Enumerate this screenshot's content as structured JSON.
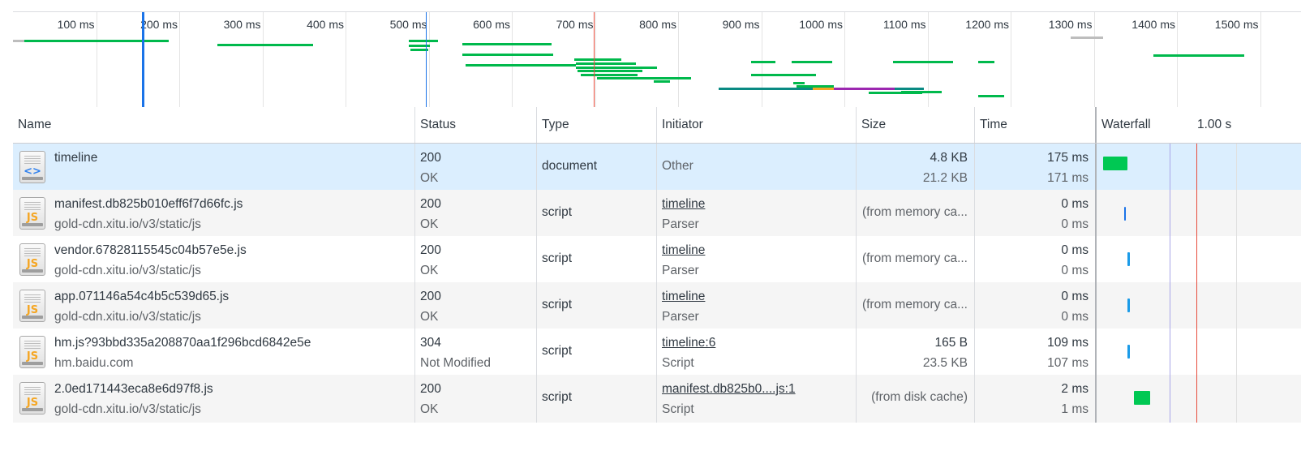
{
  "overview": {
    "tick_labels": [
      "100 ms",
      "200 ms",
      "300 ms",
      "400 ms",
      "500 ms",
      "600 ms",
      "700 ms",
      "800 ms",
      "900 ms",
      "1000 ms",
      "1100 ms",
      "1200 ms",
      "1300 ms",
      "1400 ms",
      "1500 ms"
    ],
    "colors": {
      "waiting": "#00b94c",
      "queued": "#bdbdbd",
      "dom_content_loaded": "#1a73e8",
      "load": "#e74c3c",
      "purple": "#9c27b0",
      "teal": "#0a8a83",
      "orange": "#f5a623"
    }
  },
  "columns": {
    "name": "Name",
    "status": "Status",
    "type": "Type",
    "initiator": "Initiator",
    "size": "Size",
    "time": "Time",
    "waterfall": "Waterfall",
    "waterfall_scale": "1.00 s"
  },
  "rows": [
    {
      "icon": "html-document-icon",
      "glyph": "<>",
      "name": "timeline",
      "domain": "",
      "status": "200",
      "status_text": "OK",
      "type": "document",
      "initiator": "Other",
      "initiator_sub": "",
      "size": "4.8 KB",
      "size_sub": "21.2 KB",
      "time": "175 ms",
      "time_sub": "171 ms",
      "selected": true
    },
    {
      "icon": "js-file-icon",
      "glyph": "JS",
      "name": "manifest.db825b010eff6f7d66fc.js",
      "domain": "gold-cdn.xitu.io/v3/static/js",
      "status": "200",
      "status_text": "OK",
      "type": "script",
      "initiator": "timeline",
      "initiator_sub": "Parser",
      "size": "(from memory ca...",
      "size_sub": "",
      "time": "0 ms",
      "time_sub": "0 ms",
      "selected": false
    },
    {
      "icon": "js-file-icon",
      "glyph": "JS",
      "name": "vendor.67828115545c04b57e5e.js",
      "domain": "gold-cdn.xitu.io/v3/static/js",
      "status": "200",
      "status_text": "OK",
      "type": "script",
      "initiator": "timeline",
      "initiator_sub": "Parser",
      "size": "(from memory ca...",
      "size_sub": "",
      "time": "0 ms",
      "time_sub": "0 ms",
      "selected": false
    },
    {
      "icon": "js-file-icon",
      "glyph": "JS",
      "name": "app.071146a54c4b5c539d65.js",
      "domain": "gold-cdn.xitu.io/v3/static/js",
      "status": "200",
      "status_text": "OK",
      "type": "script",
      "initiator": "timeline",
      "initiator_sub": "Parser",
      "size": "(from memory ca...",
      "size_sub": "",
      "time": "0 ms",
      "time_sub": "0 ms",
      "selected": false
    },
    {
      "icon": "js-file-icon",
      "glyph": "JS",
      "name": "hm.js?93bbd335a208870aa1f296bcd6842e5e",
      "domain": "hm.baidu.com",
      "status": "304",
      "status_text": "Not Modified",
      "type": "script",
      "initiator": "timeline:6",
      "initiator_sub": "Script",
      "size": "165 B",
      "size_sub": "23.5 KB",
      "time": "109 ms",
      "time_sub": "107 ms",
      "selected": false
    },
    {
      "icon": "js-file-icon",
      "glyph": "JS",
      "name": "2.0ed171443eca8e6d97f8.js",
      "domain": "gold-cdn.xitu.io/v3/static/js",
      "status": "200",
      "status_text": "OK",
      "type": "script",
      "initiator": "manifest.db825b0....js:1",
      "initiator_sub": "Script",
      "size": "(from disk cache)",
      "size_sub": "",
      "time": "2 ms",
      "time_sub": "1 ms",
      "selected": false
    }
  ]
}
